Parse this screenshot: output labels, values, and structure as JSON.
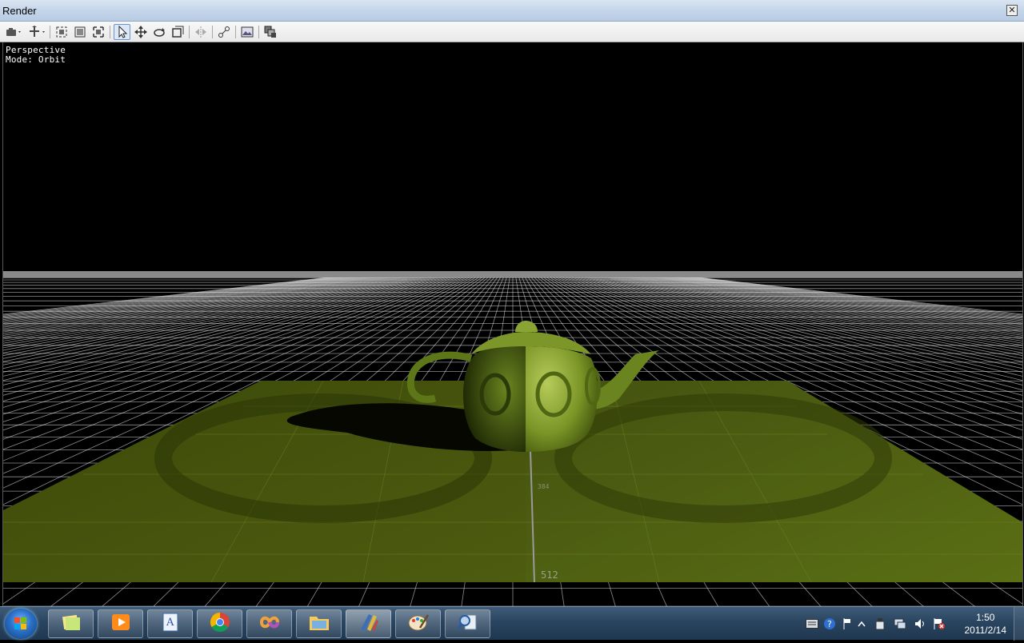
{
  "window": {
    "title": "Render",
    "close_glyph": "✕"
  },
  "toolbar": {
    "buttons": [
      {
        "name": "camera-menu-icon",
        "selected": false
      },
      {
        "name": "pan-menu-icon",
        "selected": false
      },
      {
        "name": "frame-all-icon",
        "selected": false
      },
      {
        "name": "frame-selected-icon",
        "selected": false
      },
      {
        "name": "fit-view-icon",
        "selected": false
      },
      {
        "name": "select-arrow-icon",
        "selected": true
      },
      {
        "name": "move-tool-icon",
        "selected": false
      },
      {
        "name": "rotate-tool-icon",
        "selected": false
      },
      {
        "name": "scale-tool-icon",
        "selected": false
      },
      {
        "name": "mirror-tool-icon",
        "selected": false
      },
      {
        "name": "connect-tool-icon",
        "selected": false
      },
      {
        "name": "snapshot-icon",
        "selected": false
      },
      {
        "name": "layers-icon",
        "selected": false
      }
    ]
  },
  "viewport": {
    "camera_label": "Perspective",
    "mode_label": "Mode: Orbit",
    "ruler_label": "512",
    "ruler_small_label": "384",
    "background_color": "#000000",
    "grid_color": "#ffffff",
    "floor_color": "#4b5a0c",
    "teapot_color": "#6f8c1e"
  },
  "taskbar": {
    "apps": [
      {
        "name": "sticky-notes-icon",
        "active": false
      },
      {
        "name": "media-player-icon",
        "active": false
      },
      {
        "name": "wordpad-icon",
        "active": false
      },
      {
        "name": "chrome-icon",
        "active": false
      },
      {
        "name": "visual-studio-icon",
        "active": false
      },
      {
        "name": "explorer-folder-icon",
        "active": false
      },
      {
        "name": "render-app-icon",
        "active": true
      },
      {
        "name": "paint-icon",
        "active": false
      },
      {
        "name": "search-tool-icon",
        "active": false
      }
    ],
    "tray": [
      "keyboard-icon",
      "help-icon",
      "flag-icon",
      "show-hidden-icon",
      "usb-icon",
      "network-icon",
      "volume-icon",
      "action-center-icon"
    ],
    "time": "1:50",
    "date": "2011/2/14"
  }
}
